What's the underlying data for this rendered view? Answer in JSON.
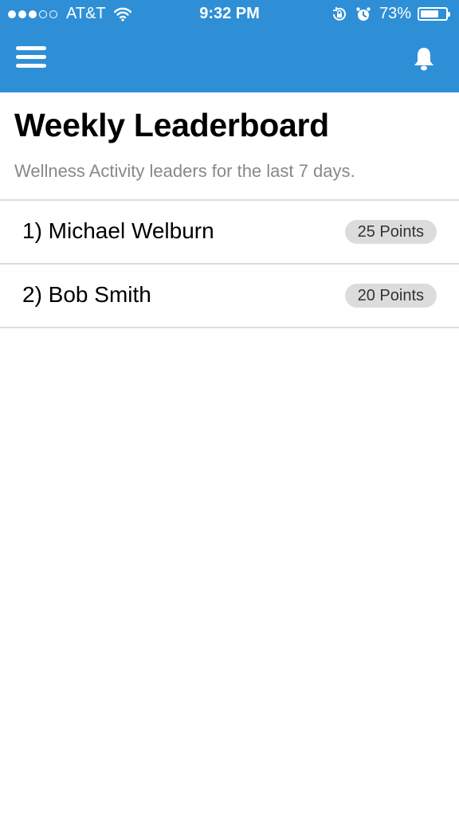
{
  "status_bar": {
    "carrier": "AT&T",
    "time": "9:32 PM",
    "battery_percent": "73%",
    "battery_level": 0.73,
    "signal_dots_full": 3,
    "signal_dots_total": 5
  },
  "nav": {
    "menu_icon": "hamburger-menu-icon",
    "notification_icon": "bell-icon",
    "bar_color": "#2e8fd6"
  },
  "header": {
    "title": "Weekly Leaderboard",
    "subtitle": "Wellness Activity leaders for the last 7 days."
  },
  "leaderboard": [
    {
      "name": "1) Michael Welburn",
      "points": "25 Points"
    },
    {
      "name": "2) Bob Smith",
      "points": "20 Points"
    }
  ]
}
